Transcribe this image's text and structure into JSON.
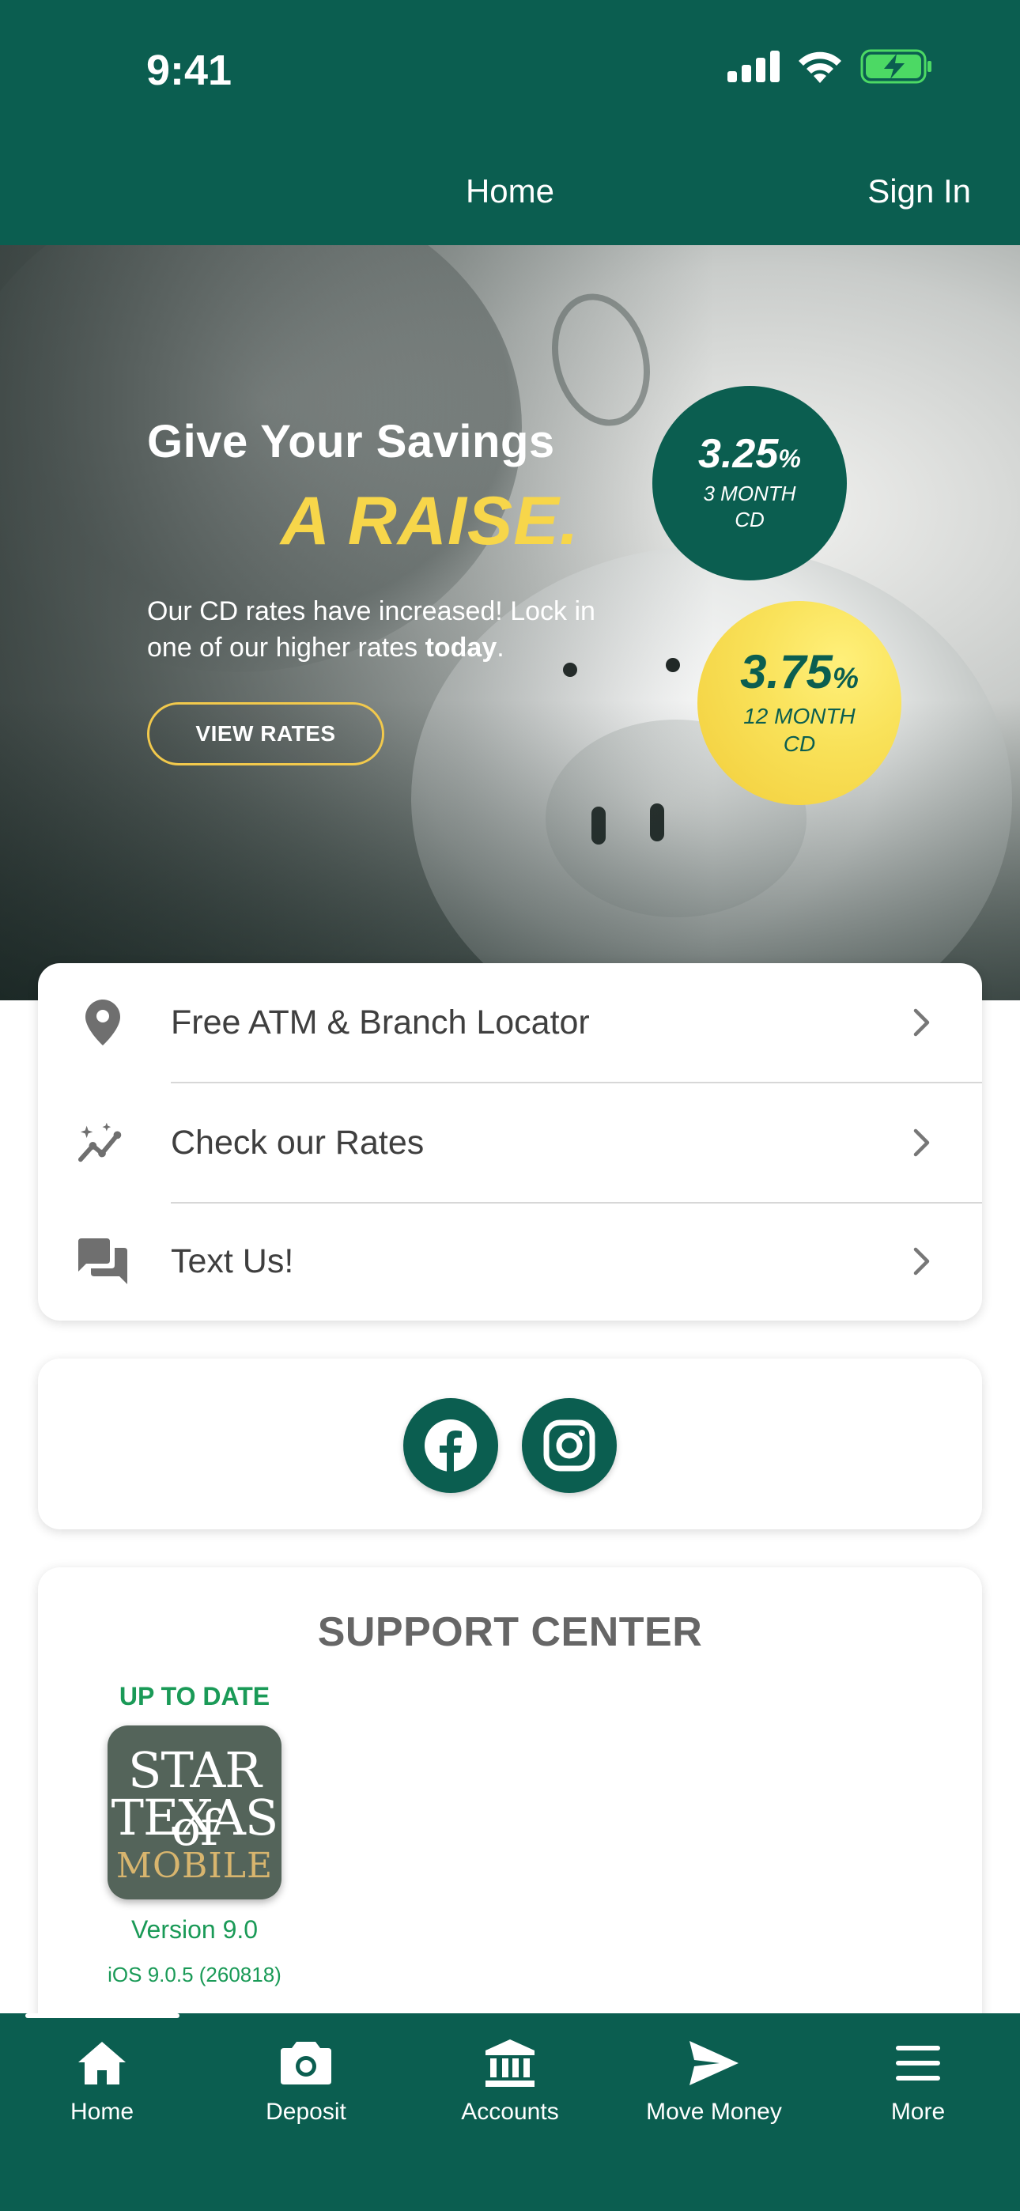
{
  "status_bar": {
    "time": "9:41"
  },
  "header": {
    "title": "Home",
    "sign_in": "Sign In"
  },
  "hero": {
    "headline": "Give Your Savings",
    "headline_accent": "A RAISE.",
    "body_prefix": "Our CD rates have increased! Lock in one of our higher rates ",
    "body_bold": "today",
    "body_suffix": ".",
    "button_label": "VIEW RATES",
    "rates": [
      {
        "value": "3.25",
        "unit": "%",
        "term_line1": "3 MONTH",
        "term_line2": "CD"
      },
      {
        "value": "3.75",
        "unit": "%",
        "term_line1": "12 MONTH",
        "term_line2": "CD"
      }
    ]
  },
  "menu": {
    "items": [
      {
        "label": "Free ATM & Branch Locator",
        "icon": "location-pin-icon"
      },
      {
        "label": "Check our Rates",
        "icon": "rates-chart-icon"
      },
      {
        "label": "Text Us!",
        "icon": "chat-icon"
      }
    ]
  },
  "social": {
    "items": [
      {
        "name": "facebook",
        "icon": "facebook-icon"
      },
      {
        "name": "instagram",
        "icon": "instagram-icon"
      }
    ]
  },
  "support": {
    "title": "SUPPORT CENTER",
    "update_status": "UP TO DATE",
    "app_logo_text": [
      "STAR of",
      "TEXAS",
      "MOBILE"
    ],
    "version": "Version 9.0",
    "build": "iOS 9.0.5 (260818)"
  },
  "tabbar": {
    "items": [
      {
        "label": "Home",
        "icon": "home-icon",
        "active": true
      },
      {
        "label": "Deposit",
        "icon": "camera-icon",
        "active": false
      },
      {
        "label": "Accounts",
        "icon": "bank-icon",
        "active": false
      },
      {
        "label": "Move Money",
        "icon": "send-icon",
        "active": false
      },
      {
        "label": "More",
        "icon": "menu-icon",
        "active": false
      }
    ]
  },
  "colors": {
    "brand_green": "#0b5e50",
    "accent_yellow": "#f7d64a",
    "status_green": "#1a9a57"
  }
}
